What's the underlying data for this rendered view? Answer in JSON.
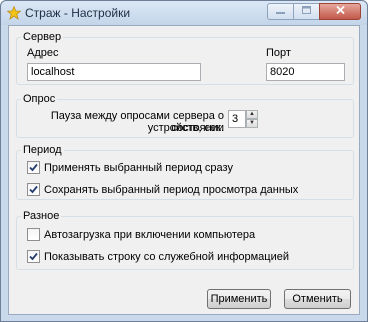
{
  "window": {
    "title": "Страж - Настройки"
  },
  "server": {
    "legend": "Сервер",
    "address_label": "Адрес",
    "address_value": "localhost",
    "port_label": "Порт",
    "port_value": "8020"
  },
  "poll": {
    "legend": "Опрос",
    "interval_label_line1": "Пауза между опросами сервера о состоянии",
    "interval_label_line2": "устройств, сек.",
    "interval_value": "3"
  },
  "period": {
    "legend": "Период",
    "apply_immediately_label": "Применять выбранный период сразу",
    "apply_immediately_checked": true,
    "save_period_label": "Сохранять выбранный период просмотра данных",
    "save_period_checked": true
  },
  "misc": {
    "legend": "Разное",
    "autostart_label": "Автозагрузка при включении компьютера",
    "autostart_checked": false,
    "show_service_line_label": "Показывать строку со служебной информацией",
    "show_service_line_checked": true
  },
  "buttons": {
    "apply": "Применить",
    "cancel": "Отменить"
  },
  "icons": {
    "app": "star-icon",
    "minimize": "minimize-icon",
    "maximize": "maximize-icon",
    "close": "close-icon"
  }
}
